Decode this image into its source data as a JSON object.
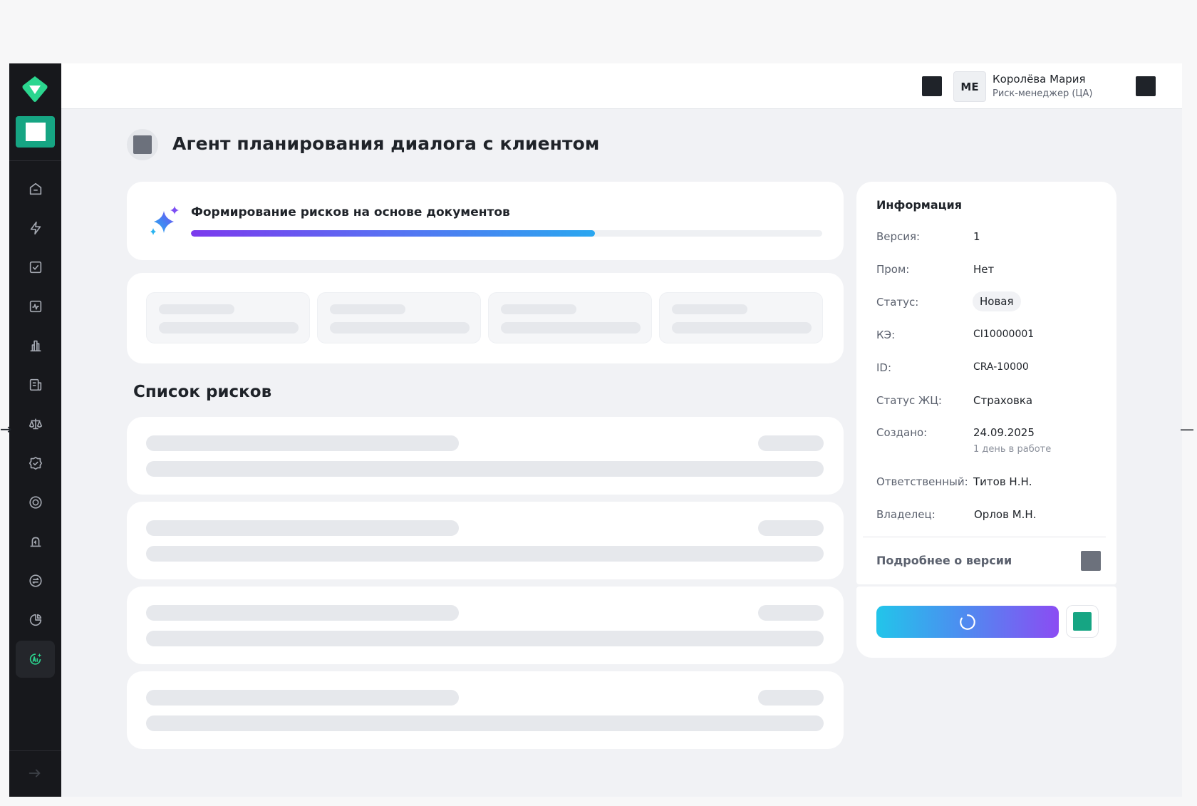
{
  "header": {
    "user": {
      "initials": "МЕ",
      "name": "Королёва Мария",
      "role": "Риск-менеджер (ЦА)"
    }
  },
  "sidebar": {
    "items": [
      {
        "icon": "home-icon"
      },
      {
        "icon": "lightning-icon"
      },
      {
        "icon": "checkbox-icon"
      },
      {
        "icon": "activity-icon"
      },
      {
        "icon": "bar-chart-icon"
      },
      {
        "icon": "document-icon"
      },
      {
        "icon": "scales-icon"
      },
      {
        "icon": "badge-check-icon"
      },
      {
        "icon": "target-icon"
      },
      {
        "icon": "alarm-icon"
      },
      {
        "icon": "exchange-icon"
      },
      {
        "icon": "pie-chart-icon"
      },
      {
        "icon": "ai-icon",
        "active": true
      }
    ]
  },
  "page": {
    "title": "Агент планирования диалога с клиентом"
  },
  "progress": {
    "label": "Формирование рисков на основе документов",
    "fraction": 0.64
  },
  "risks": {
    "section_title": "Список рисков"
  },
  "info": {
    "title": "Информация",
    "fields": {
      "version": {
        "label": "Версия:",
        "value": "1"
      },
      "prom": {
        "label": "Пром:",
        "value": "Нет"
      },
      "status": {
        "label": "Статус:",
        "value": "Новая"
      },
      "ke": {
        "label": "КЭ:",
        "value": "CI10000001"
      },
      "id": {
        "label": "ID:",
        "value": "CRA-10000"
      },
      "lifecycle": {
        "label": "Статус ЖЦ:",
        "value": "Страховка"
      },
      "created": {
        "label": "Создано:",
        "value": "24.09.2025",
        "note": "1 день в работе"
      },
      "responsible": {
        "label": "Ответственный:",
        "value": "Титов Н.Н."
      },
      "owner": {
        "label": "Владелец:",
        "value": "Орлов М.Н."
      }
    },
    "more_label": "Подробнее о версии"
  },
  "colors": {
    "accent": "#16a583",
    "sidebar_bg": "#17181c",
    "page_bg": "#f1f2f5"
  }
}
